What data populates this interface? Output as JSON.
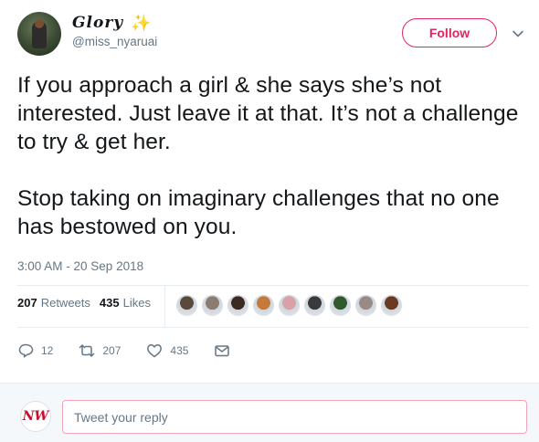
{
  "author": {
    "display_name": "Glory",
    "handle": "@miss_nyaruai",
    "emoji": "✨"
  },
  "follow_label": "Follow",
  "tweet": {
    "paragraphs": [
      "If you approach a girl & she says she’s not interested. Just leave it at that. It’s not a challenge to try & get her.",
      "Stop taking on imaginary challenges that no one has bestowed on you."
    ],
    "timestamp": "3:00 AM - 20 Sep 2018"
  },
  "stats": {
    "retweets_count": "207",
    "retweets_label": "Retweets",
    "likes_count": "435",
    "likes_label": "Likes"
  },
  "likers": [
    {
      "color": "#5a4a3c"
    },
    {
      "color": "#8a7d70"
    },
    {
      "color": "#3b2a22"
    },
    {
      "color": "#c47a3a"
    },
    {
      "color": "#d9a0a8"
    },
    {
      "color": "#3a3a3a"
    },
    {
      "color": "#2e5a2e"
    },
    {
      "color": "#9a8a86"
    },
    {
      "color": "#6b3a22"
    }
  ],
  "actions": {
    "reply_count": "12",
    "retweet_count": "207",
    "like_count": "435"
  },
  "reply": {
    "avatar_text": "NW",
    "placeholder": "Tweet your reply"
  },
  "colors": {
    "follow_accent": "#e0245e",
    "muted_text": "#657786",
    "divider": "#e6ecf0"
  }
}
